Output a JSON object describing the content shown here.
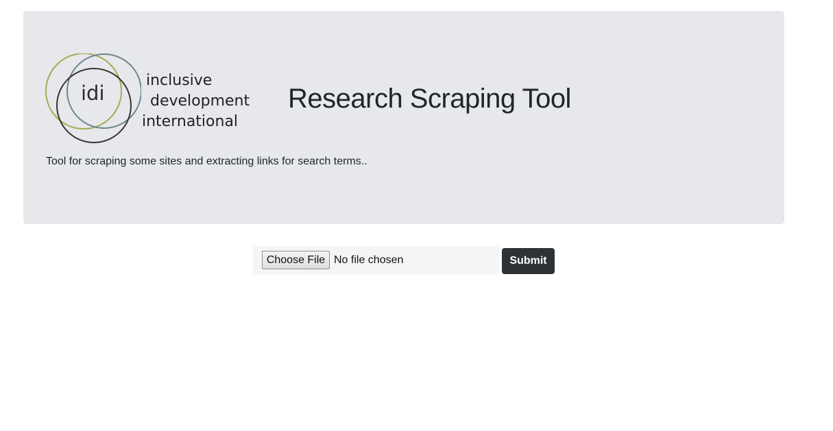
{
  "header": {
    "logo": {
      "mark_text": "idi",
      "word_lines": [
        "inclusive",
        "development",
        "international"
      ],
      "ring_colors": [
        "#a3ad52",
        "#6d8590",
        "#3a3331"
      ]
    },
    "title": "Research Scraping Tool",
    "lead": "Tool for scraping some sites and extracting links for search terms.."
  },
  "form": {
    "choose_file_label": "Choose File",
    "file_status": "No file chosen",
    "submit_label": "Submit"
  },
  "colors": {
    "jumbotron_bg": "#e6e8ec",
    "submit_bg": "#2d3236",
    "file_box_bg": "#f4f5f7"
  }
}
